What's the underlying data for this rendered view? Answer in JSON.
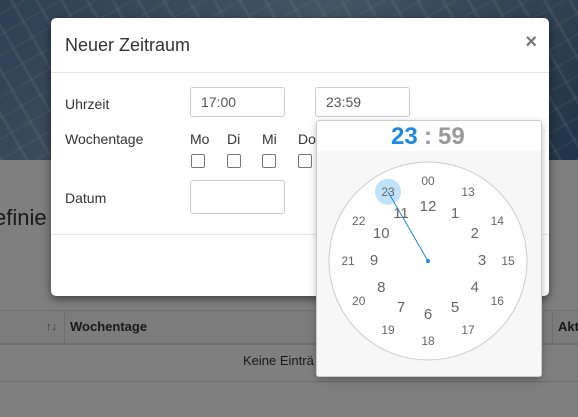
{
  "background": {
    "heading": "efinie",
    "table": {
      "sort_indicator": "↑↓",
      "col_weekdays": "Wochentage",
      "col_actions": "Akt",
      "empty_text": "Keine Einträ"
    }
  },
  "modal": {
    "title": "Neuer Zeitraum",
    "close": "×",
    "time_label": "Uhrzeit",
    "time_from": "17:00",
    "time_to": "23:59",
    "weekdays_label": "Wochentage",
    "weekdays": [
      "Mo",
      "Di",
      "Mi",
      "Do"
    ],
    "date_label": "Datum",
    "date_value": ""
  },
  "clockpicker": {
    "hour": "23",
    "separator": ":",
    "minute": "59",
    "selected_hour": 23,
    "inner_hours": [
      "12",
      "1",
      "2",
      "3",
      "4",
      "5",
      "6",
      "7",
      "8",
      "9",
      "10",
      "11"
    ],
    "outer_hours": [
      "00",
      "13",
      "14",
      "15",
      "16",
      "17",
      "18",
      "19",
      "20",
      "21",
      "22",
      "23"
    ],
    "accent_color": "#1e88e5",
    "selected_bg": "#c0e3fb"
  }
}
